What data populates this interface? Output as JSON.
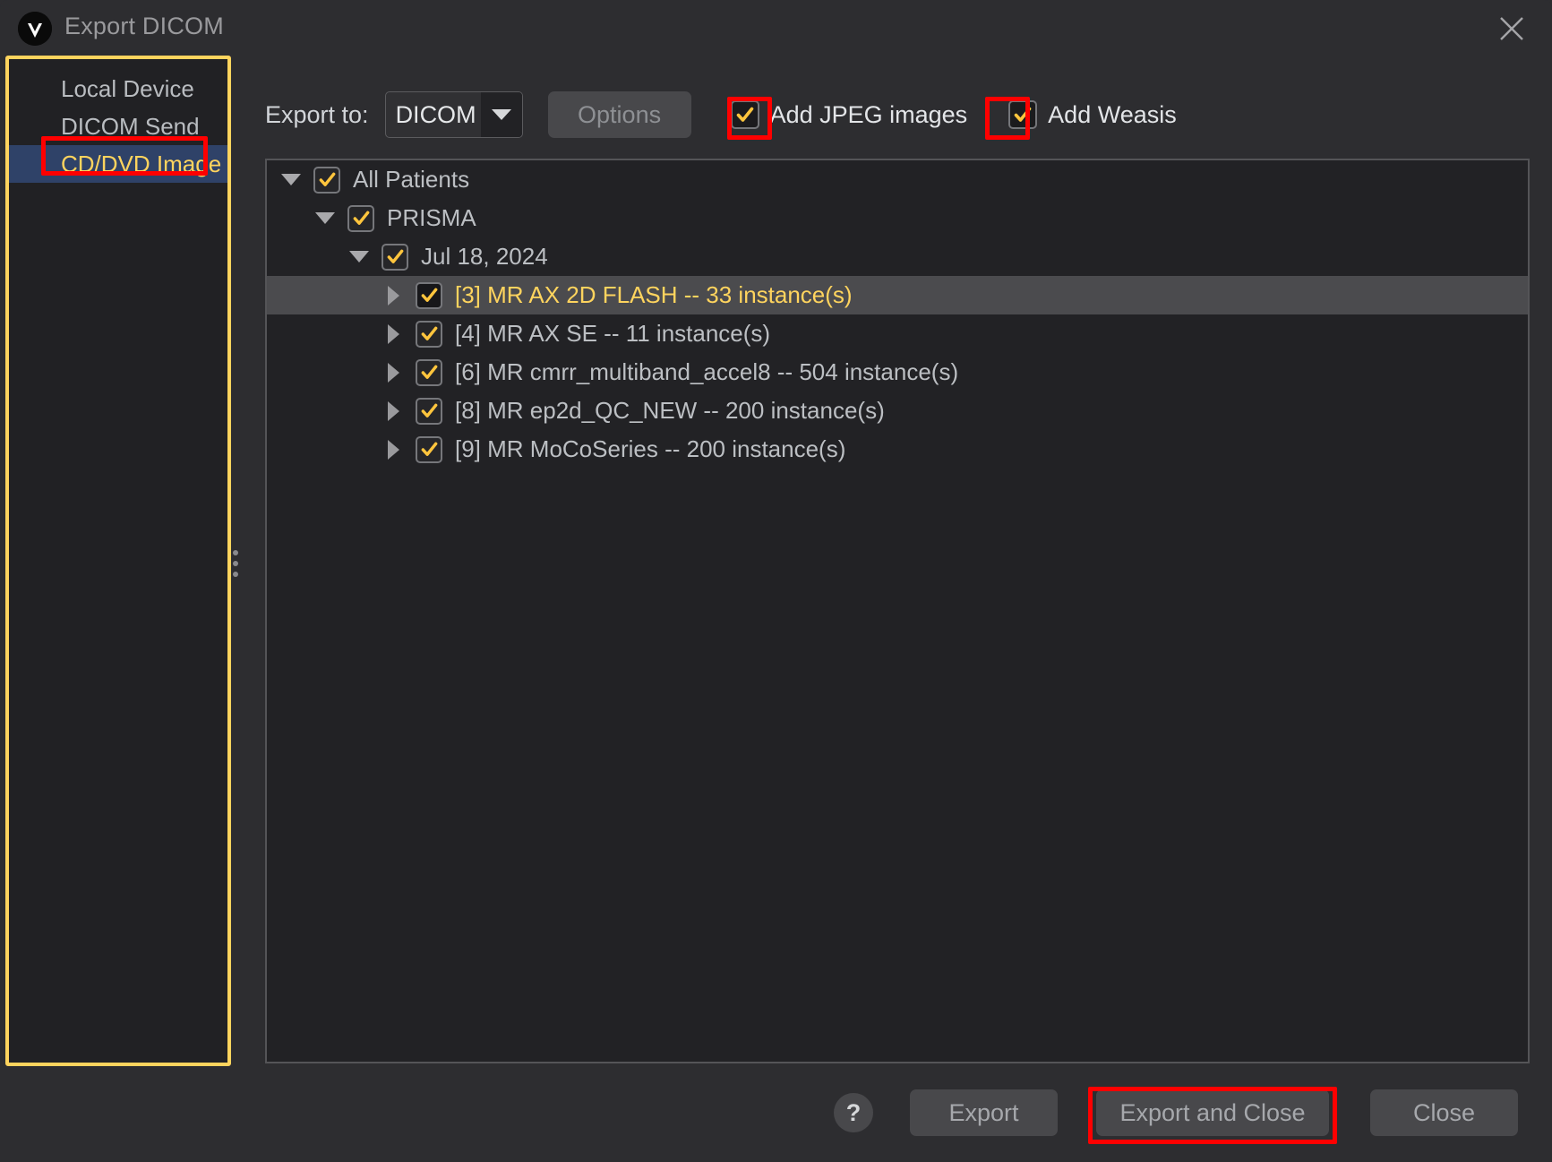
{
  "window": {
    "title": "Export DICOM",
    "logo_icon": "weasis-logo-icon",
    "close_icon": "close-icon"
  },
  "sidebar": {
    "items": [
      {
        "label": "Local Device",
        "selected": false
      },
      {
        "label": "DICOM Send",
        "selected": false
      },
      {
        "label": "CD/DVD Image",
        "selected": true
      }
    ]
  },
  "toolbar": {
    "export_to_label": "Export to:",
    "export_to_value": "DICOM",
    "dropdown_icon": "chevron-down-icon",
    "options_label": "Options",
    "checkboxes": [
      {
        "label": "Add JPEG images",
        "checked": true
      },
      {
        "label": "Add Weasis",
        "checked": true
      }
    ]
  },
  "tree": {
    "rows": [
      {
        "label": "All Patients",
        "indent": 0,
        "expander": "down",
        "checked": true,
        "selected": false
      },
      {
        "label": "PRISMA",
        "indent": 1,
        "expander": "down",
        "checked": true,
        "selected": false
      },
      {
        "label": "Jul 18, 2024",
        "indent": 2,
        "expander": "down",
        "checked": true,
        "selected": false
      },
      {
        "label": "[3] MR AX 2D FLASH -- 33 instance(s)",
        "indent": 3,
        "expander": "right",
        "checked": true,
        "selected": true
      },
      {
        "label": "[4] MR AX SE -- 11 instance(s)",
        "indent": 3,
        "expander": "right",
        "checked": true,
        "selected": false
      },
      {
        "label": "[6] MR cmrr_multiband_accel8 -- 504 instance(s)",
        "indent": 3,
        "expander": "right",
        "checked": true,
        "selected": false
      },
      {
        "label": "[8] MR ep2d_QC_NEW -- 200 instance(s)",
        "indent": 3,
        "expander": "right",
        "checked": true,
        "selected": false
      },
      {
        "label": "[9] MR MoCoSeries -- 200 instance(s)",
        "indent": 3,
        "expander": "right",
        "checked": true,
        "selected": false
      }
    ]
  },
  "footer": {
    "help_label": "?",
    "export_label": "Export",
    "export_and_close_label": "Export and Close",
    "close_label": "Close"
  },
  "colors": {
    "dialog_background": "#2d2d30",
    "panel_background": "#222225",
    "accent_yellow": "#ffd45e",
    "selection_blue": "#2f4268",
    "annotation_red": "#ff0000",
    "row_selection_gray": "#4b4b4e",
    "text_primary": "#d2d5d9",
    "text_muted": "#8e9094"
  }
}
